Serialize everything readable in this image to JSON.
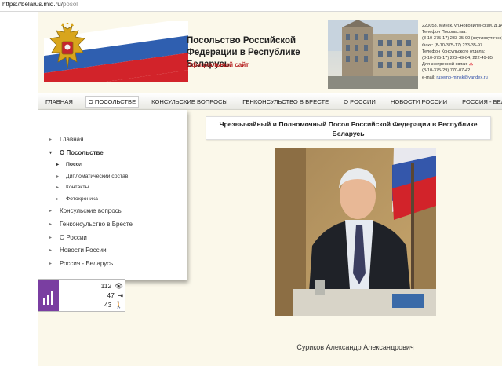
{
  "browser": {
    "url_host": "https://belarus.mid.ru/",
    "url_path": "posol"
  },
  "header": {
    "title": "Посольство Российской Федерации в Республике Беларусь",
    "subtitle": "Официальный сайт",
    "contacts": [
      "220053, Минск, ул.Нововиленская, д.1А",
      "Телефон Посольства:",
      "(8-10-375-17) 233-35-90 (круглосуточно)",
      "Факс: (8-10-375-17) 233-35-97",
      "Телефон Консульского отдела:",
      "(8-10-375-17) 222-49-84, 222-49-85"
    ],
    "emergency_label": "Для экстренной связи:",
    "emergency_phone": "(8-10-375-29) 770-07-42",
    "email_label": "e-mail:",
    "email": "rusemb-minsk@yandex.ru"
  },
  "nav": {
    "items": [
      {
        "label": "ГЛАВНАЯ"
      },
      {
        "label": "О ПОСОЛЬСТВЕ"
      },
      {
        "label": "КОНСУЛЬСКИЕ ВОПРОСЫ"
      },
      {
        "label": "ГЕНКОНСУЛЬСТВО В БРЕСТЕ"
      },
      {
        "label": "О РОССИИ"
      },
      {
        "label": "НОВОСТИ РОССИИ"
      },
      {
        "label": "РОССИЯ - БЕЛАРУСЬ"
      }
    ],
    "active": "О ПОСОЛЬСТВЕ"
  },
  "sidebar": {
    "items": [
      {
        "label": "Главная"
      },
      {
        "label": "О Посольстве"
      },
      {
        "label": "Посол"
      },
      {
        "label": "Дипломатический состав"
      },
      {
        "label": "Контакты"
      },
      {
        "label": "Фотохроника"
      },
      {
        "label": "Консульские вопросы"
      },
      {
        "label": "Генконсульство в Бресте"
      },
      {
        "label": "О России"
      },
      {
        "label": "Новости России"
      },
      {
        "label": "Россия - Беларусь"
      }
    ]
  },
  "counter": {
    "views": "112",
    "visits": "47",
    "visitors": "43"
  },
  "main": {
    "title": "Чрезвычайный и Полномочный Посол Российской Федерации в Республике Беларусь",
    "caption": "Суриков Александр Александрович"
  },
  "colors": {
    "page_bg": "#fbf8ea",
    "accent_red": "#b51d1d",
    "counter_badge": "#7a3ea1"
  }
}
